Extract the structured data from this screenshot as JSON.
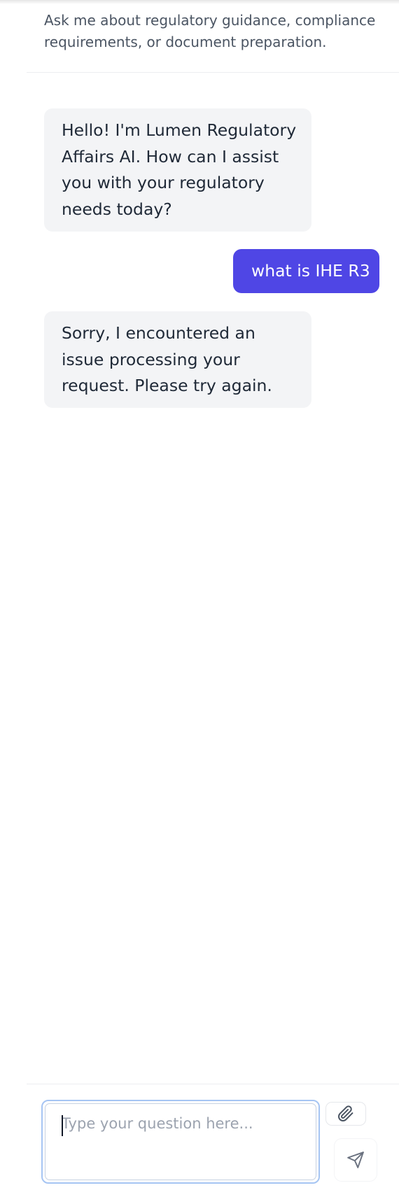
{
  "header": {
    "description": "Ask me about regulatory guidance, compliance requirements, or document preparation."
  },
  "messages": [
    {
      "role": "assistant",
      "text": "Hello! I'm Lumen Regulatory Affairs AI. How can I assist you with your regulatory needs today?"
    },
    {
      "role": "user",
      "text": "what is IHE R3"
    },
    {
      "role": "assistant",
      "text": "Sorry, I encountered an issue processing your request. Please try again."
    }
  ],
  "composer": {
    "placeholder": "Type your question here...",
    "value": "",
    "attach_icon": "paperclip-icon",
    "send_icon": "send-icon"
  },
  "colors": {
    "accent": "#4f46e5",
    "assistant_bubble": "#f3f4f6",
    "input_focus_border": "#a6c5f3"
  }
}
